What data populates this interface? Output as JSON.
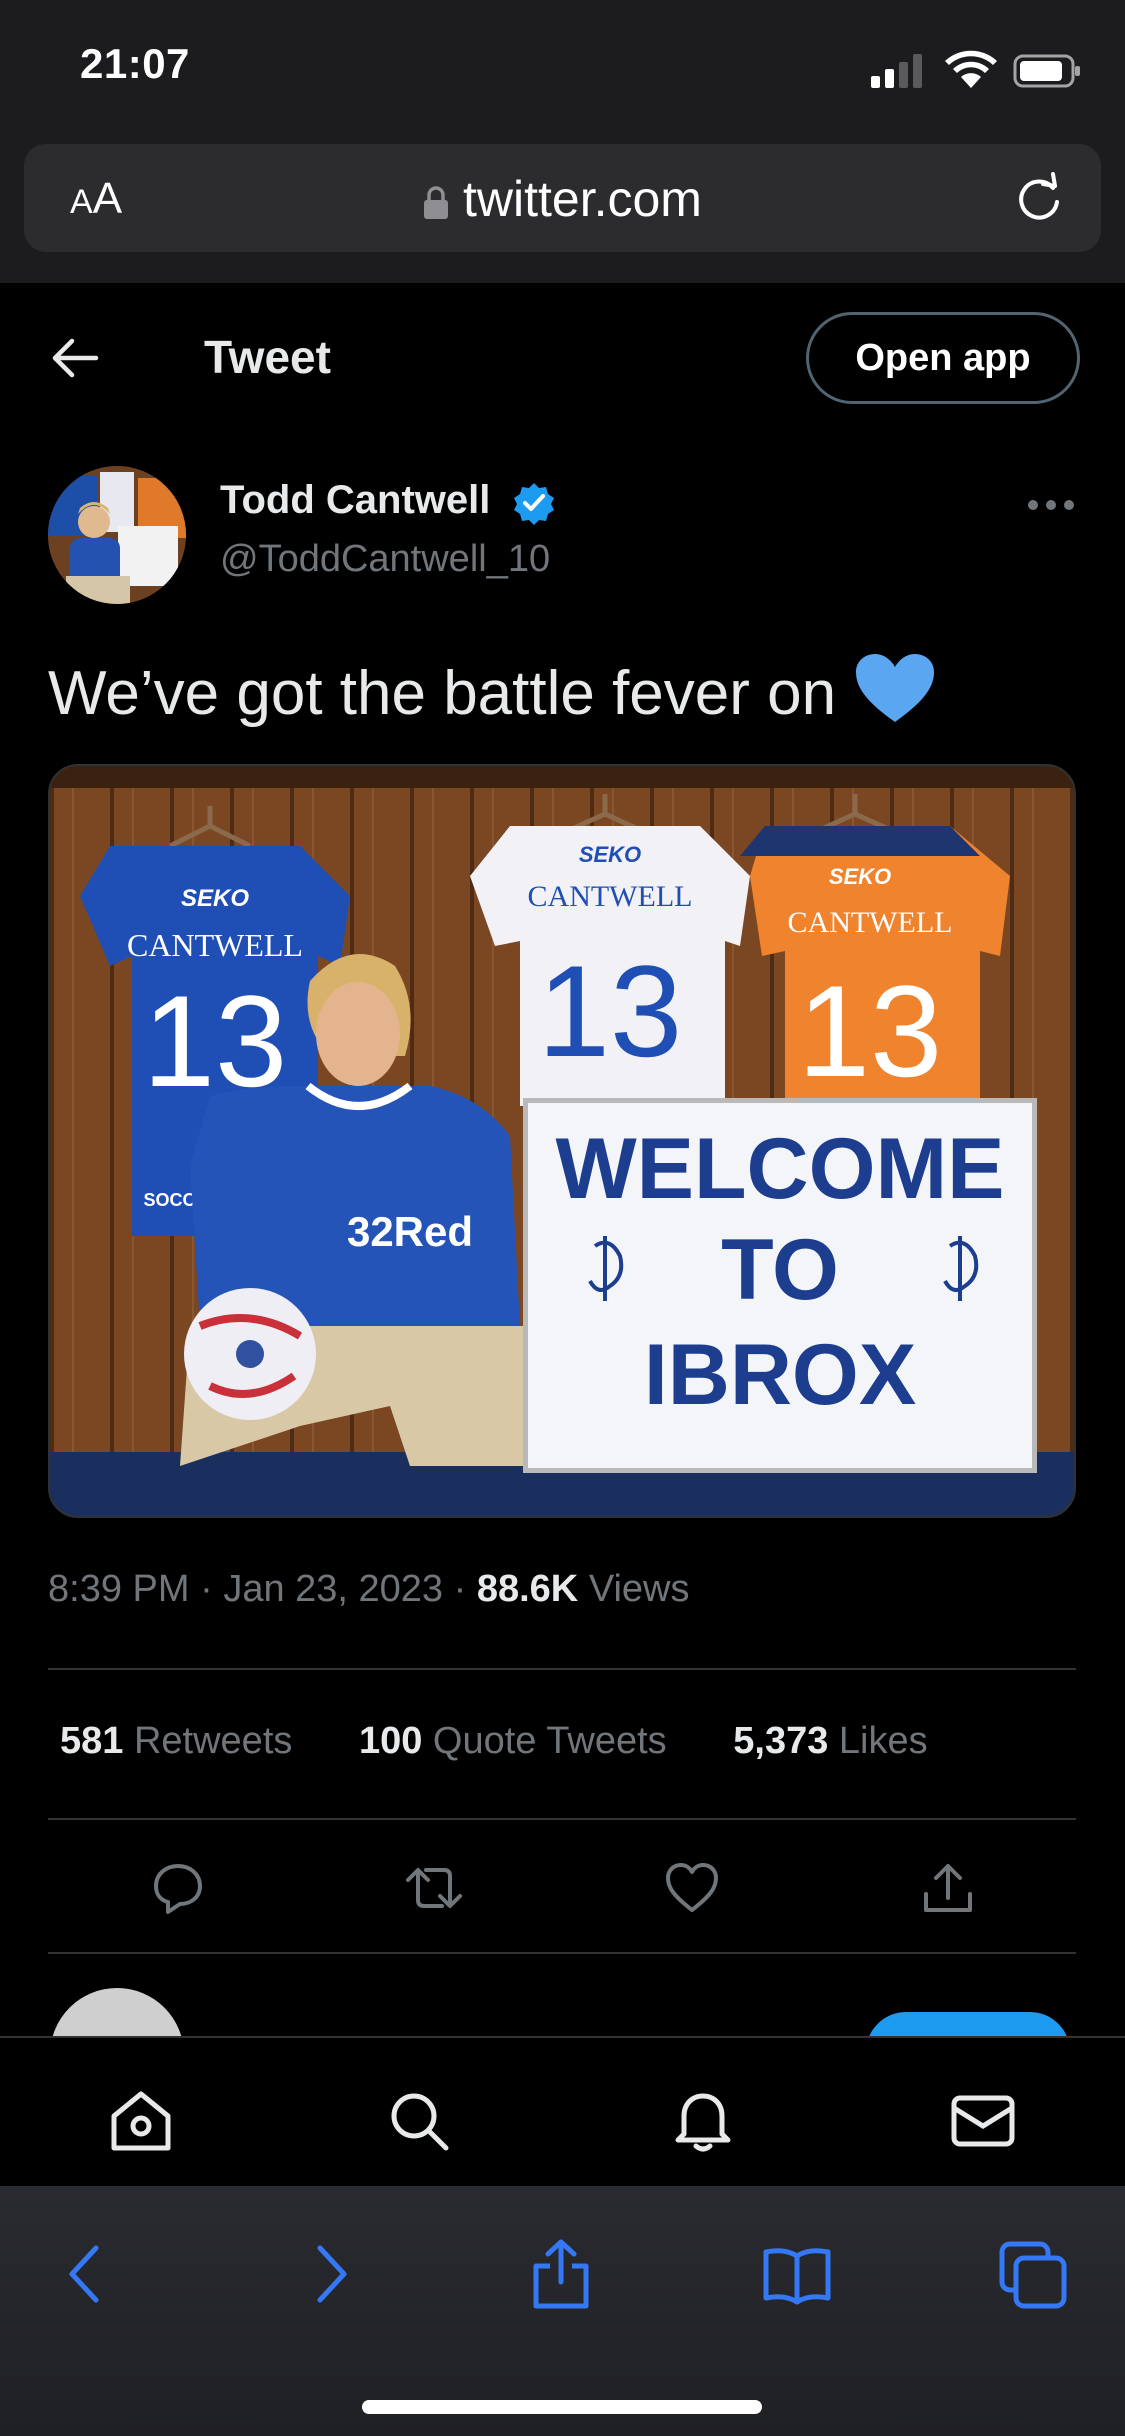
{
  "status_bar": {
    "time": "21:07"
  },
  "safari": {
    "text_size_small": "A",
    "text_size_big": "A",
    "url": "twitter.com"
  },
  "header": {
    "title": "Tweet",
    "open_app_label": "Open app"
  },
  "author": {
    "name": "Todd Cantwell",
    "handle": "@ToddCantwell_10",
    "verified": true
  },
  "tweet": {
    "text": "We’ve got the battle fever on",
    "emoji": "blue-heart",
    "image_sign": {
      "line1": "WELCOME",
      "line2": "TO",
      "line3": "IBROX"
    },
    "image_texts": {
      "sponsor": "SEKO",
      "player_name": "CANTWELL",
      "number": "13",
      "shirt_sponsor": "32Red",
      "partner": "SOCO"
    }
  },
  "meta": {
    "time": "8:39 PM",
    "separator": "·",
    "date": "Jan 23, 2023",
    "views_count": "88.6K",
    "views_label": "Views"
  },
  "stats": [
    {
      "count": "581",
      "label": "Retweets"
    },
    {
      "count": "100",
      "label": "Quote Tweets"
    },
    {
      "count": "5,373",
      "label": "Likes"
    }
  ],
  "actions": [
    "reply-icon",
    "retweet-icon",
    "like-icon",
    "share-icon"
  ],
  "tabbar": [
    "home-icon",
    "search-icon",
    "notifications-icon",
    "messages-icon"
  ],
  "safari_toolbar": [
    "back-icon",
    "forward-icon",
    "share-icon",
    "bookmarks-icon",
    "tabs-icon"
  ],
  "colors": {
    "accent": "#1d9bf0",
    "safari_accent": "#3478f6",
    "muted": "#71767b",
    "divider": "#2f3336"
  }
}
